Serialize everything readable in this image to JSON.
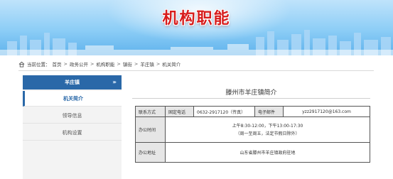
{
  "banner": {
    "title": "机构职能"
  },
  "breadcrumb": {
    "label": "当前位置：",
    "items": [
      "首页",
      "政务公开",
      "机构职能",
      "镇街",
      "羊庄镇",
      "机关简介"
    ],
    "separator": ">"
  },
  "sidebar": {
    "header": "羊庄镇",
    "items": [
      {
        "label": "机关简介",
        "active": true
      },
      {
        "label": "领导信息",
        "active": false
      },
      {
        "label": "机构设置",
        "active": false
      }
    ]
  },
  "main": {
    "title": "滕州市羊庄镇简介",
    "contact": {
      "label": "联系方式",
      "phone_label": "固定电话",
      "phone_value": "0632-2917120（传真）",
      "email_label": "电子邮件",
      "email_value": "yzz2917120@163.com"
    },
    "hours": {
      "label": "办公时间",
      "line1": "上午8:30-12:00，下午13:00-17:30",
      "line2": "（周一至周五，法定节假日除外）"
    },
    "address": {
      "label": "办公地址",
      "value": "山东省滕州市羊庄镇政府驻地"
    }
  },
  "colors": {
    "accent": "#2a68a8",
    "title_red": "#d71c1c"
  }
}
